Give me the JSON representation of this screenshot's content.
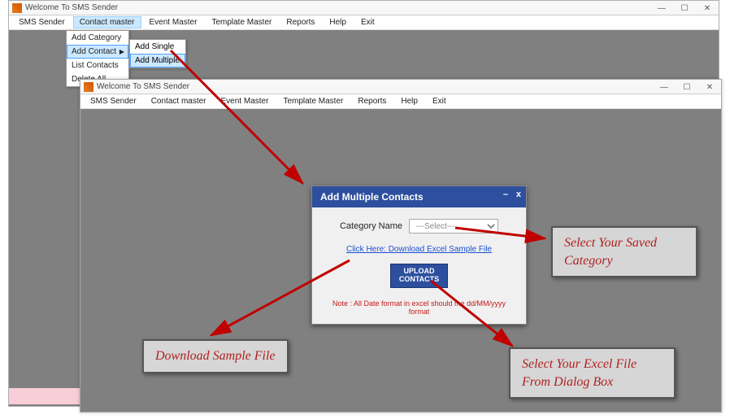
{
  "win1": {
    "title": "Welcome To SMS Sender",
    "menu": [
      "SMS Sender",
      "Contact master",
      "Event Master",
      "Template Master",
      "Reports",
      "Help",
      "Exit"
    ],
    "open_menu_index": 1,
    "dropdown1": [
      "Add Category",
      "Add Contact",
      "List Contacts",
      "Delete All"
    ],
    "dropdown1_sel": 1,
    "dropdown2": [
      "Add Single",
      "Add Multiple"
    ],
    "dropdown2_sel": 1
  },
  "win2": {
    "title": "Welcome To SMS Sender",
    "menu": [
      "SMS Sender",
      "Contact master",
      "Event Master",
      "Template Master",
      "Reports",
      "Help",
      "Exit"
    ]
  },
  "dialog": {
    "title": "Add Multiple Contacts",
    "category_label": "Category Name",
    "category_placeholder": "---Select---",
    "download_link": "Click Here: Download Excel Sample File",
    "upload_btn_line1": "UPLOAD",
    "upload_btn_line2": "CONTACTS",
    "note": "Note : All Date format in excel should me dd/MM/yyyy format"
  },
  "annotations": {
    "select_category": "Select Your Saved\nCategory",
    "download_sample": "Download Sample File",
    "select_excel": "Select Your Excel File\nFrom Dialog Box"
  },
  "window_controls": {
    "min": "—",
    "max": "☐",
    "close": "✕"
  }
}
